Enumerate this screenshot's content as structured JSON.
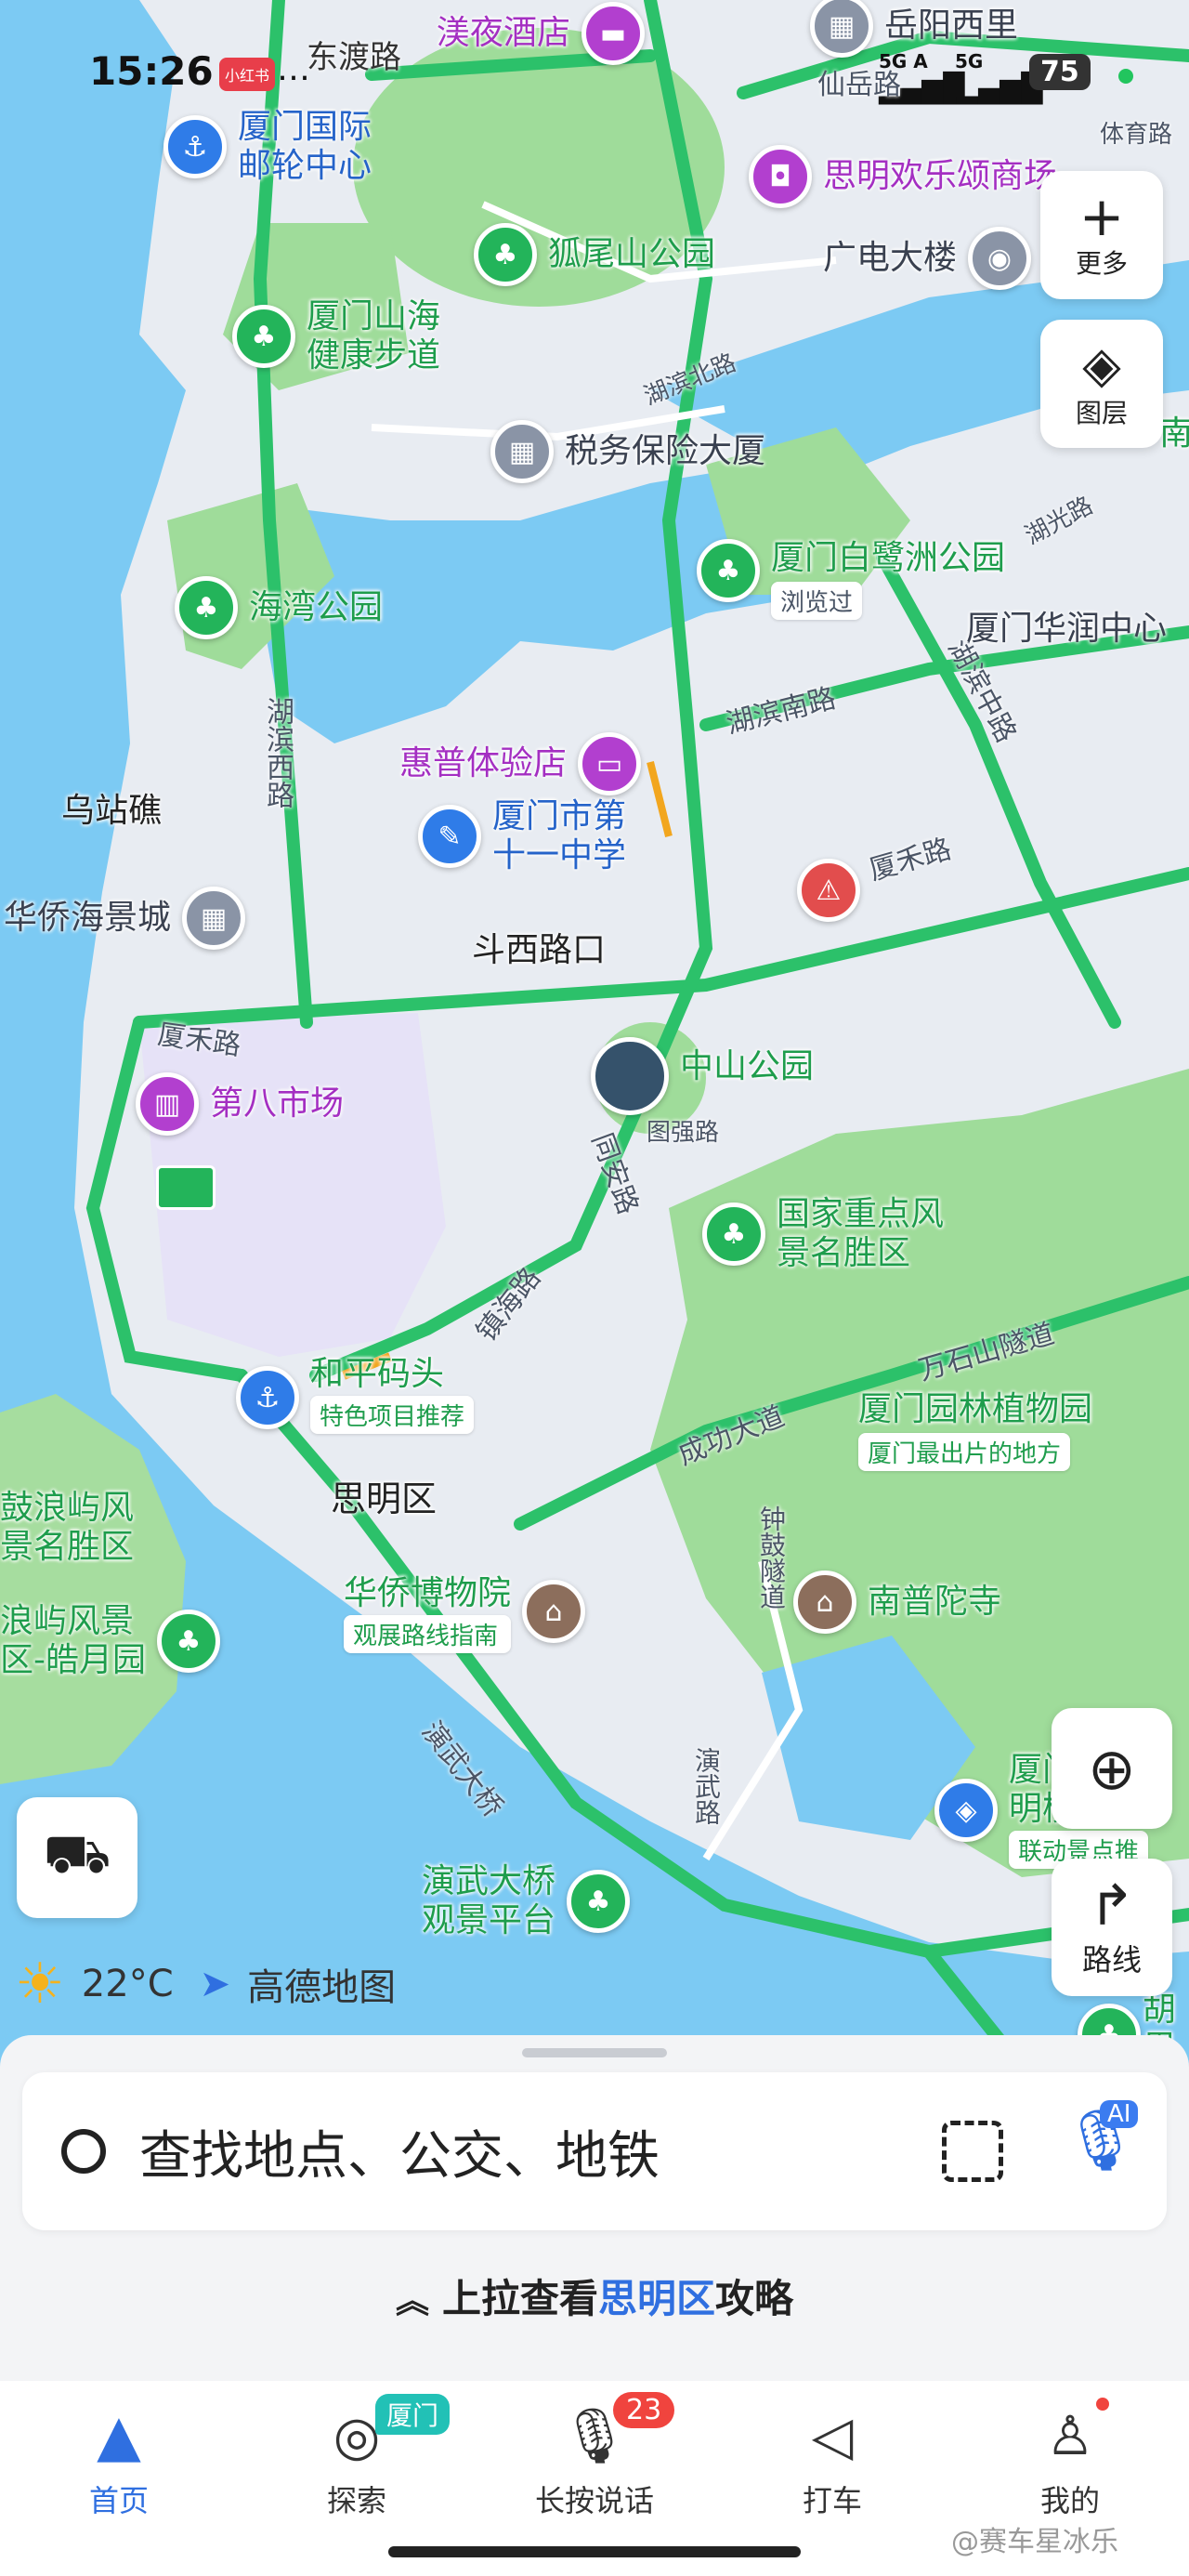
{
  "status_bar": {
    "time": "15:26",
    "app_badge": "小红书",
    "more": "…",
    "network_a": "5G A",
    "network_b": "5G",
    "battery": "75"
  },
  "map": {
    "pois": {
      "hotel": "渼夜酒店",
      "yueyang": "岳阳西里",
      "cruise": "厦门国际\n邮轮中心",
      "mall": "思明欢乐颂商场",
      "huwei": "狐尾山公园",
      "guangdian": "广电大楼",
      "shanhai": "厦门山海\n健康步道",
      "shuiwu": "税务保险大厦",
      "haiwan": "海湾公园",
      "bailuzhou": "厦门白鹭洲公园",
      "bailuzhou_tag": "浏览过",
      "huarun": "厦门华润中心",
      "huipu": "惠普体验店",
      "school": "厦门市第\n十一中学",
      "wuzhanjiao": "乌站礁",
      "huaqiao_hj": "华侨海景城",
      "douxi": "斗西路口",
      "zhongshan": "中山公园",
      "market": "第八市场",
      "scenic": "国家重点风\n景名胜区",
      "heping": "和平码头",
      "heping_tag": "特色项目推荐",
      "botanical": "厦门园林植物园",
      "botanical_tag": "厦门最出片的地方",
      "siming": "思明区",
      "gulangyu": "鼓浪屿风\n景名胜区",
      "haoyue": "浪屿风景\n区-皓月园",
      "museum": "华侨博物院",
      "museum_tag": "观展路线指南",
      "nanputuo": "南普陀寺",
      "yanwu": "演武大桥\n观景平台",
      "xiamen_u": "厦门\n明楼",
      "xiamen_u_tag": "联动景点推",
      "hu_edge": "胡里",
      "nan_edge": "南"
    },
    "roads": {
      "dongdu": "东渡路",
      "xianyue": "仙岳路",
      "tiyu": "体育路",
      "hubin_n": "湖滨北路",
      "hubin_w": "湖滨西路",
      "hubin_s": "湖滨南路",
      "hubin_m": "湖滨中路",
      "huguang": "湖光路",
      "xiahe": "厦禾路",
      "xiahe2": "厦禾路",
      "tongan": "同安路",
      "tuqiang": "图强路",
      "zhenhai": "镇海路",
      "wanshi": "万石山隧道",
      "chengong": "成功大道",
      "zhonggu": "钟鼓隧道",
      "yanwu_bridge": "演武大桥",
      "yanwu_rd": "演武路"
    }
  },
  "controls": {
    "more": "更多",
    "layers": "图层",
    "route": "路线"
  },
  "weather": {
    "temp": "22°C",
    "brand": "高德地图"
  },
  "search": {
    "placeholder": "查找地点、公交、地铁",
    "ai_badge": "AI"
  },
  "pullup": {
    "prefix": "上拉查看",
    "district": "思明区",
    "suffix": "攻略"
  },
  "tabs": [
    {
      "label": "首页"
    },
    {
      "label": "探索",
      "badge": "厦门"
    },
    {
      "label": "长按说话",
      "badge": "23"
    },
    {
      "label": "打车"
    },
    {
      "label": "我的"
    }
  ],
  "watermark": "@赛车星冰乐",
  "colors": {
    "water": "#7ccaf3",
    "park": "#9fdc9a",
    "road_green": "#2cc16a",
    "accent": "#2f6fe0"
  }
}
